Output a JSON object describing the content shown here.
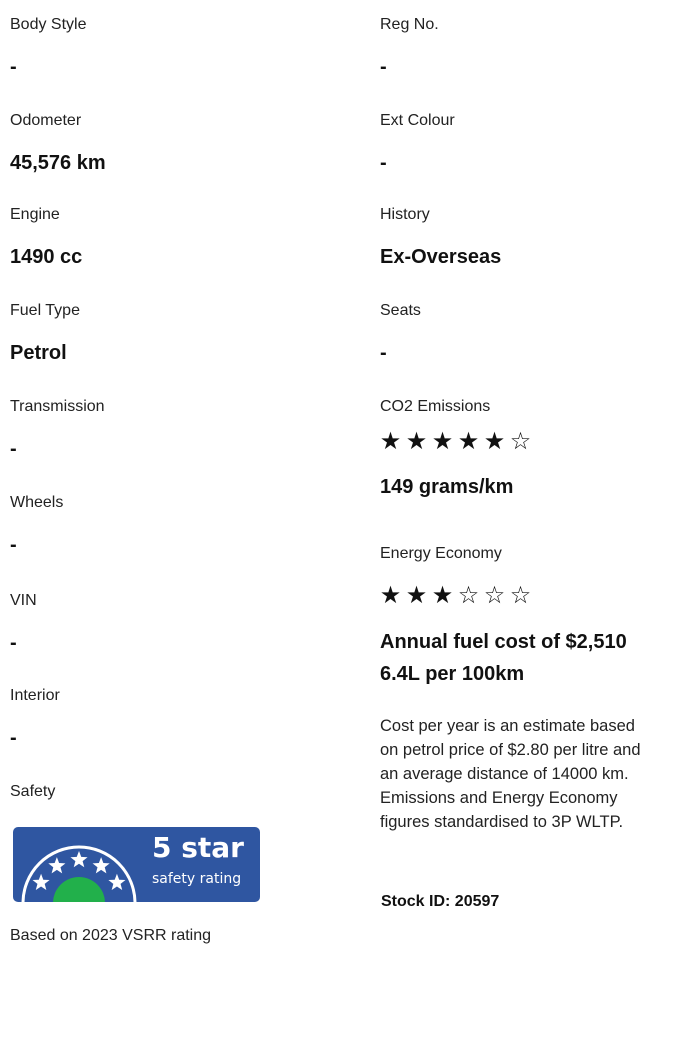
{
  "left_specs": [
    {
      "label": "Body Style",
      "value": "-"
    },
    {
      "label": "Odometer",
      "value": "45,576 km"
    },
    {
      "label": "Engine",
      "value": "1490 cc"
    },
    {
      "label": "Fuel Type",
      "value": "Petrol"
    },
    {
      "label": "Transmission",
      "value": "-"
    },
    {
      "label": "Wheels",
      "value": "-"
    },
    {
      "label": "VIN",
      "value": "-"
    },
    {
      "label": "Interior",
      "value": "-"
    }
  ],
  "right_specs": [
    {
      "label": "Reg No.",
      "value": "-"
    },
    {
      "label": "Ext Colour",
      "value": "-"
    },
    {
      "label": "History",
      "value": "Ex-Overseas"
    },
    {
      "label": "Seats",
      "value": "-"
    }
  ],
  "safety": {
    "label": "Safety",
    "badge_line1": "5 star",
    "badge_line2": "safety rating",
    "badge_stars": 5,
    "based_on": "Based on 2023 VSRR rating",
    "badge_bg_color": "#2f56a1",
    "badge_dome_color": "#22b04b"
  },
  "co2": {
    "label": "CO2 Emissions",
    "rating": 5,
    "out_of": 6,
    "value": "149 grams/km"
  },
  "energy": {
    "label": "Energy Economy",
    "rating": 3,
    "out_of": 6,
    "annual_cost": "Annual fuel cost of $2,510",
    "consumption": "6.4L per 100km"
  },
  "note_lines": [
    "Cost per year is an estimate based",
    "on petrol price of  $2.80 per litre and",
    "an average distance of 14000 km.",
    "Emissions and Energy Economy",
    "figures standardised to 3P WLTP."
  ],
  "stock_id": "Stock ID: 20597"
}
